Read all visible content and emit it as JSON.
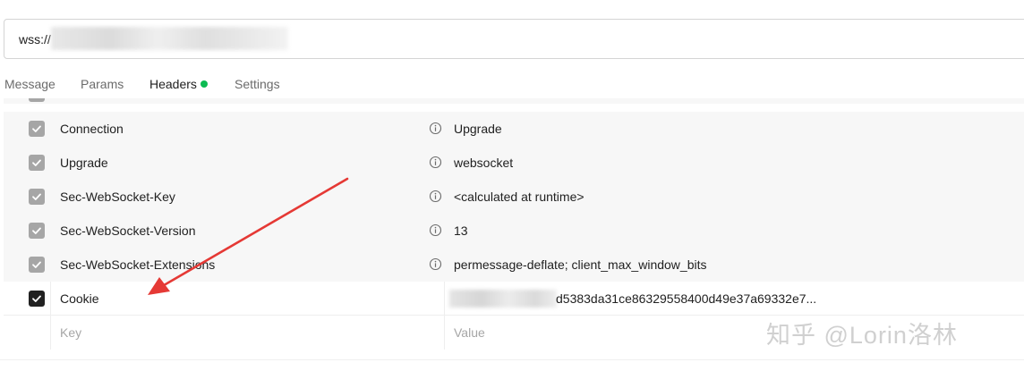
{
  "request": {
    "url_prefix": "wss://"
  },
  "tabs": [
    {
      "label": "Message"
    },
    {
      "label": "Params"
    },
    {
      "label": "Headers"
    },
    {
      "label": "Settings"
    }
  ],
  "headers": [
    {
      "key": "Connection",
      "value": "Upgrade",
      "checked": true
    },
    {
      "key": "Upgrade",
      "value": "websocket",
      "checked": true
    },
    {
      "key": "Sec-WebSocket-Key",
      "value": "<calculated at runtime>",
      "checked": true
    },
    {
      "key": "Sec-WebSocket-Version",
      "value": "13",
      "checked": true
    },
    {
      "key": "Sec-WebSocket-Extensions",
      "value": "permessage-deflate; client_max_window_bits",
      "checked": true
    }
  ],
  "cookie_row": {
    "key": "Cookie",
    "value_visible": "d5383da31ce86329558400d49e37a69332e7...",
    "checked": true
  },
  "new_row": {
    "key_placeholder": "Key",
    "value_placeholder": "Value"
  },
  "watermark": {
    "text": "知乎 @Lorin洛林"
  },
  "colors": {
    "accent": "#ff6c37",
    "status_dot": "#0cbb52",
    "arrow": "#e53935"
  }
}
